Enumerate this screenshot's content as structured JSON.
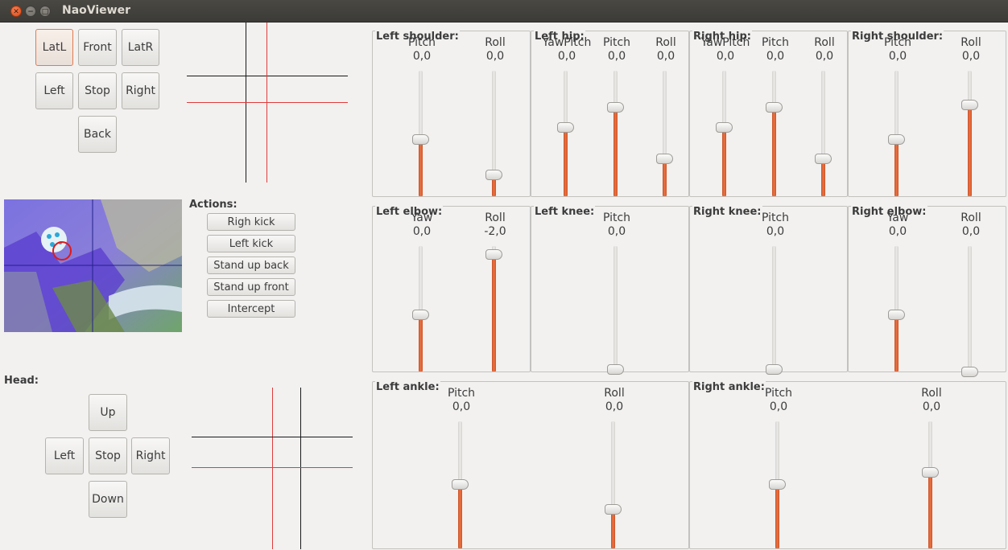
{
  "window": {
    "title": "NaoViewer"
  },
  "walk": {
    "buttons": [
      "LatL",
      "Front",
      "LatR",
      "Left",
      "Stop",
      "Right",
      "Back"
    ],
    "selected": "LatL"
  },
  "actions": {
    "label": "Actions:",
    "buttons": [
      "Righ kick",
      "Left kick",
      "Stand up back",
      "Stand up front",
      "Intercept"
    ]
  },
  "head": {
    "label": "Head:",
    "buttons": [
      "Up",
      "Left",
      "Stop",
      "Right",
      "Down"
    ]
  },
  "colors": {
    "accent": "#e8683a",
    "crosshair_black": "#1a1a1a",
    "crosshair_red": "#e03c3c"
  },
  "joints": [
    {
      "name": "Left shoulder:",
      "sliders": [
        {
          "label": "Pitch",
          "value": "0,0",
          "level": 0.5
        },
        {
          "label": "Roll",
          "value": "0,0",
          "level": 0.21
        }
      ]
    },
    {
      "name": "Left hip:",
      "sliders": [
        {
          "label": "YawPitch",
          "value": "0,0",
          "level": 0.6
        },
        {
          "label": "Pitch",
          "value": "0,0",
          "level": 0.77
        },
        {
          "label": "Roll",
          "value": "0,0",
          "level": 0.34
        }
      ]
    },
    {
      "name": "Right hip:",
      "sliders": [
        {
          "label": "YawPitch",
          "value": "0,0",
          "level": 0.6
        },
        {
          "label": "Pitch",
          "value": "0,0",
          "level": 0.77
        },
        {
          "label": "Roll",
          "value": "0,0",
          "level": 0.34
        }
      ]
    },
    {
      "name": "Right shoulder:",
      "sliders": [
        {
          "label": "Pitch",
          "value": "0,0",
          "level": 0.5
        },
        {
          "label": "Roll",
          "value": "0,0",
          "level": 0.79
        }
      ]
    },
    {
      "name": "Left elbow:",
      "sliders": [
        {
          "label": "Yaw",
          "value": "0,0",
          "level": 0.5
        },
        {
          "label": "Roll",
          "value": "-2,0",
          "level": 1.0
        }
      ]
    },
    {
      "name": "Left knee:",
      "sliders": [
        {
          "label": "Pitch",
          "value": "0,0",
          "level": 0.05
        }
      ]
    },
    {
      "name": "Right knee:",
      "sliders": [
        {
          "label": "Pitch",
          "value": "0,0",
          "level": 0.05
        }
      ]
    },
    {
      "name": "Right elbow:",
      "sliders": [
        {
          "label": "Yaw",
          "value": "0,0",
          "level": 0.5
        },
        {
          "label": "Roll",
          "value": "0,0",
          "level": 0.03
        }
      ]
    },
    {
      "name": "Left ankle:",
      "sliders": [
        {
          "label": "Pitch",
          "value": "0,0",
          "level": 0.55
        },
        {
          "label": "Roll",
          "value": "0,0",
          "level": 0.35
        }
      ]
    },
    {
      "name": "Right ankle:",
      "sliders": [
        {
          "label": "Pitch",
          "value": "0,0",
          "level": 0.55
        },
        {
          "label": "Roll",
          "value": "0,0",
          "level": 0.65
        }
      ]
    }
  ]
}
